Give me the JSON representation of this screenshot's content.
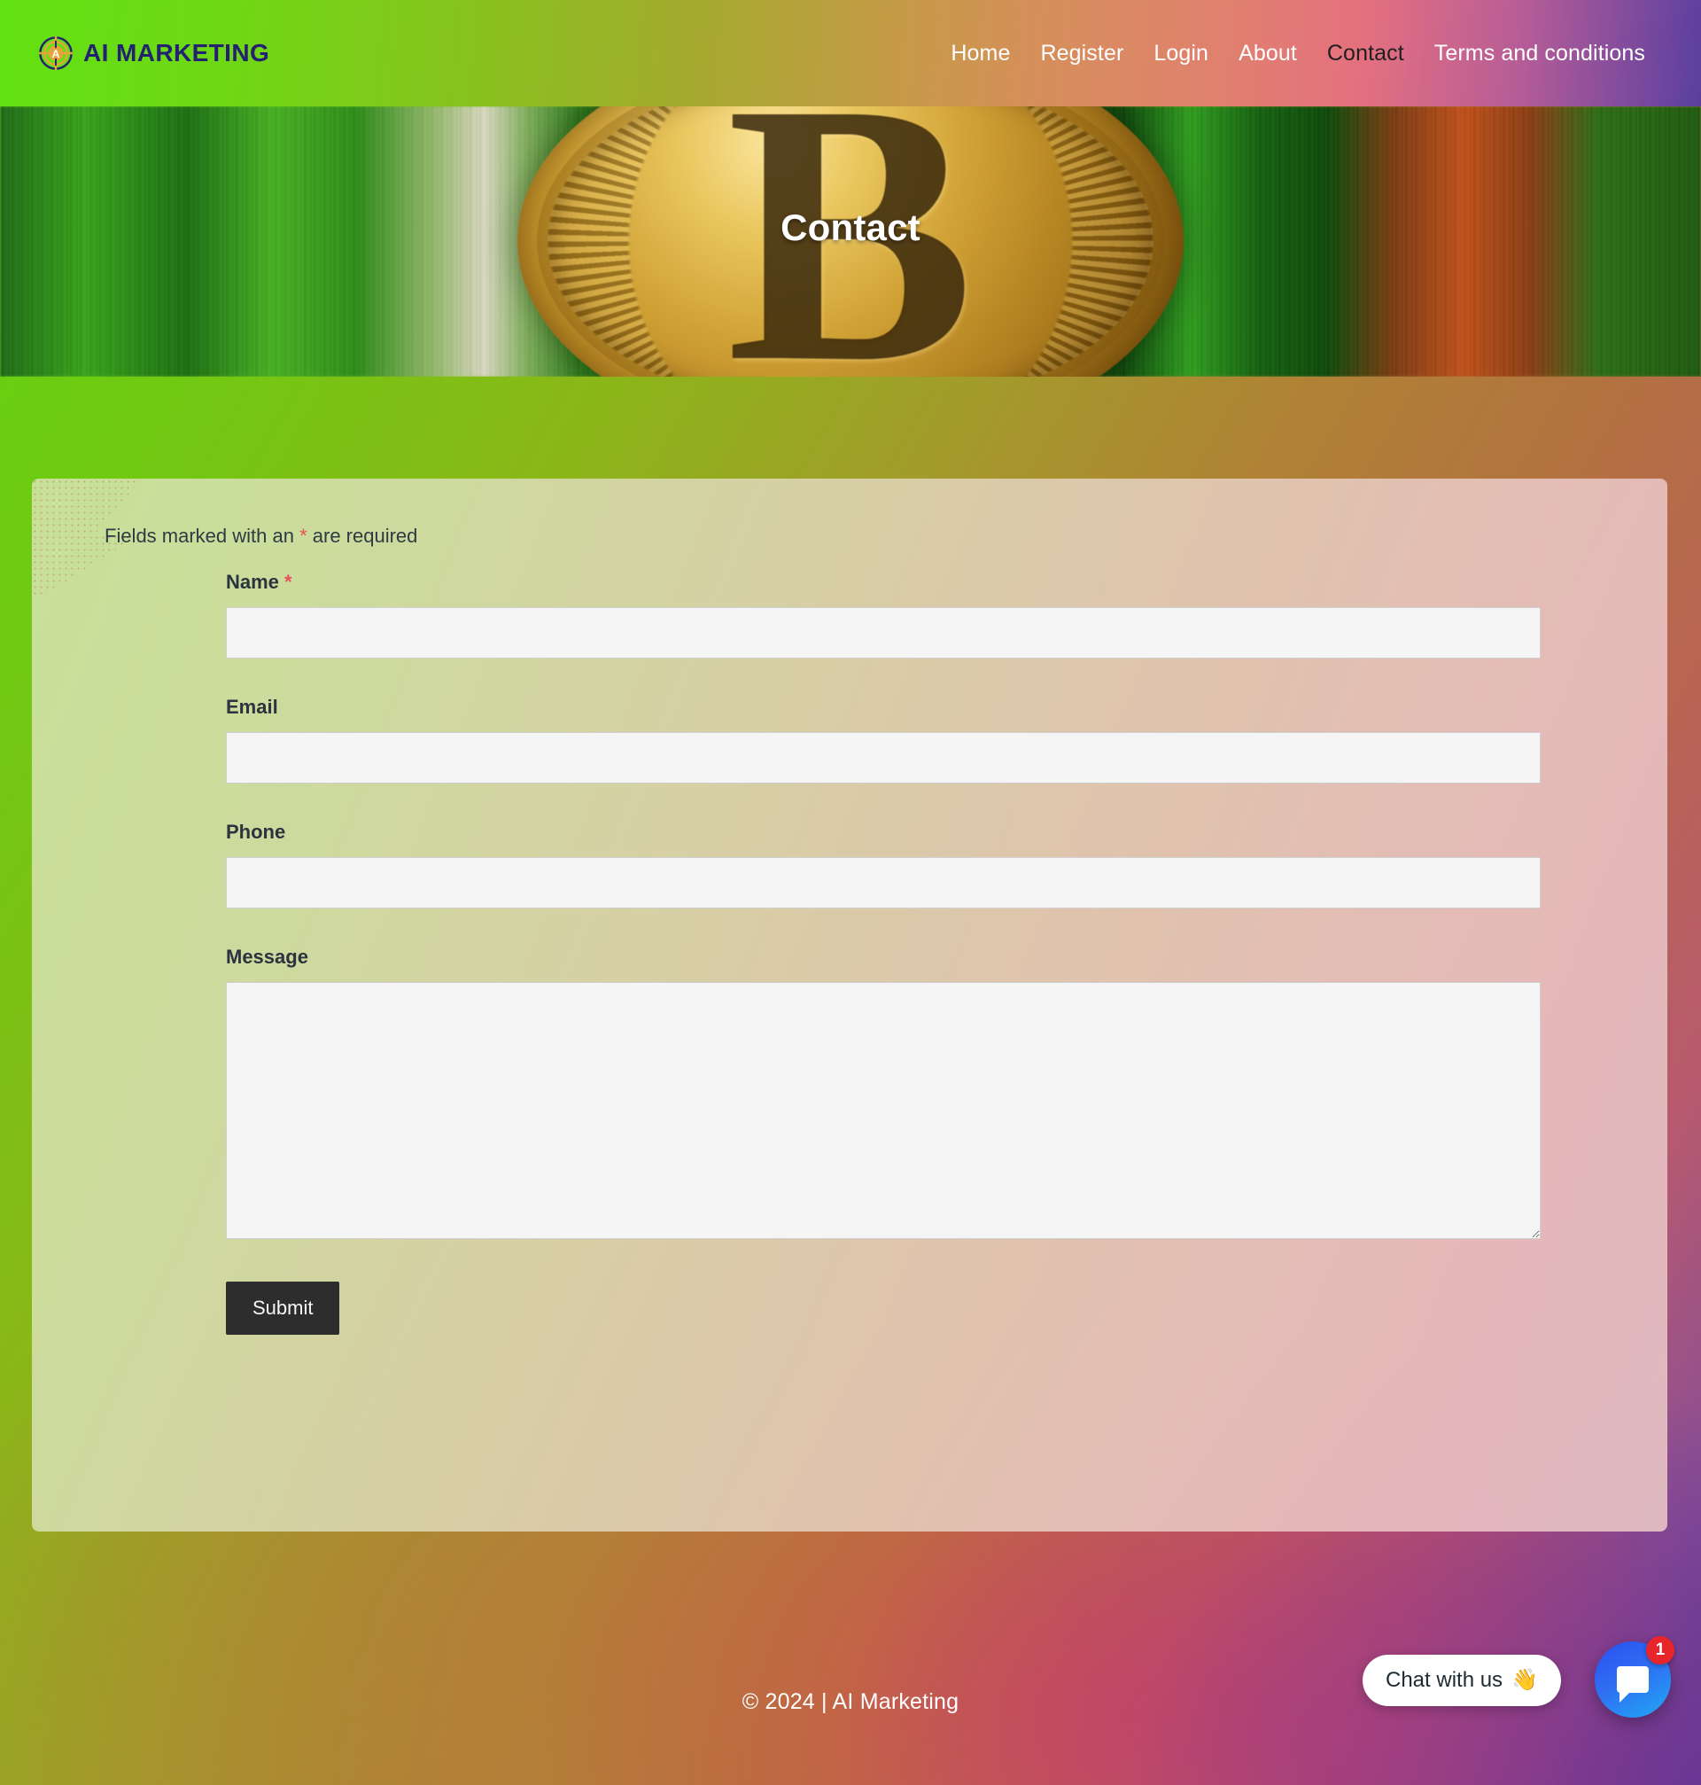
{
  "navbar": {
    "brand": {
      "icon": "target-crosshair-logo-icon",
      "text": "AI MARKETING",
      "color": "#222270",
      "accent": "#e8a33d"
    },
    "links": [
      {
        "label": "Home",
        "active": false
      },
      {
        "label": "Register",
        "active": false
      },
      {
        "label": "Login",
        "active": false
      },
      {
        "label": "About",
        "active": false
      },
      {
        "label": "Contact",
        "active": true
      },
      {
        "label": "Terms and conditions",
        "active": false
      }
    ]
  },
  "hero": {
    "title": "Contact",
    "image": "bitcoin-coin-photo"
  },
  "form": {
    "required_note_prefix": "Fields marked with an ",
    "required_star": "*",
    "required_note_suffix": " are required",
    "fields": [
      {
        "label": "Name",
        "required": true,
        "star": "*",
        "value": "",
        "placeholder": "",
        "type": "text"
      },
      {
        "label": "Email",
        "required": false,
        "star": "",
        "value": "",
        "placeholder": "",
        "type": "text"
      },
      {
        "label": "Phone",
        "required": false,
        "star": "",
        "value": "",
        "placeholder": "",
        "type": "text"
      },
      {
        "label": "Message",
        "required": false,
        "star": "",
        "value": "",
        "placeholder": "",
        "type": "textarea"
      }
    ],
    "submit_label": "Submit"
  },
  "footer": {
    "text": "© 2024 | AI Marketing"
  },
  "chat_widget": {
    "pill_text": "Chat with us",
    "pill_emoji": "👋",
    "fab_icon": "chat-bubble-icon",
    "badge_count": "1",
    "badge_color": "#e8252b",
    "fab_color": "#2f6ef2"
  },
  "theme": {
    "nav_gradient_start": "#62e212",
    "nav_gradient_end": "#5a3fa0",
    "page_gradient_start": "#5fd40f",
    "page_gradient_end": "#5e3f9e",
    "card_bg_start": "#cbe19e",
    "card_bg_end": "#e5c1c4",
    "submit_bg": "#2d2d2d",
    "required_star_color": "#e8505b",
    "input_bg": "#f5f5f5",
    "label_color": "#2b333e"
  }
}
